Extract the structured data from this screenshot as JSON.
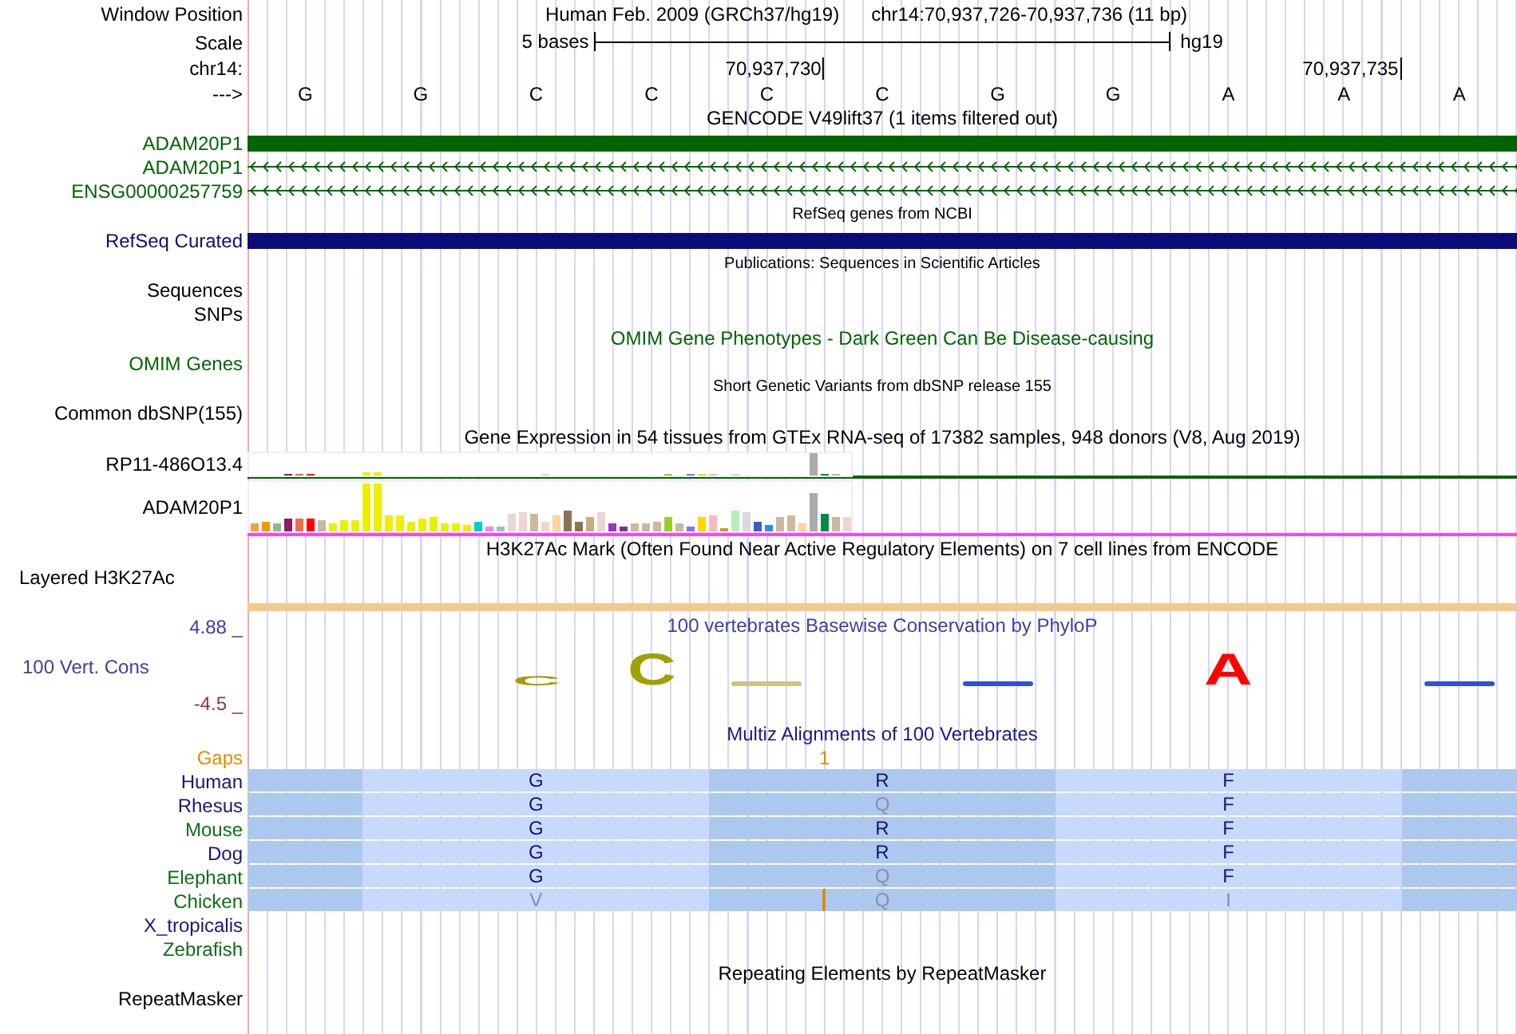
{
  "header": {
    "labels": [
      "Window Position",
      "Scale",
      "chr14:",
      "--->"
    ],
    "assembly": "Human Feb. 2009 (GRCh37/hg19)",
    "region": "chr14:70,937,726-70,937,736 (11 bp)",
    "scale_text": "5 bases",
    "scale_db": "hg19",
    "positions": [
      "70,937,730",
      "70,937,735"
    ],
    "bases": [
      "G",
      "G",
      "C",
      "C",
      "C",
      "C",
      "G",
      "G",
      "A",
      "A",
      "A"
    ]
  },
  "tracks": [
    {
      "kind": "title",
      "text": "GENCODE V49lift37 (1 items filtered out)",
      "color": "#000000"
    },
    {
      "kind": "bar",
      "label": "ADAM20P1",
      "color": "#006400"
    },
    {
      "kind": "arrows",
      "label": "ADAM20P1",
      "color": "#006400"
    },
    {
      "kind": "arrows",
      "label": "ENSG00000257759",
      "color": "#006400"
    },
    {
      "kind": "note",
      "text": "RefSeq genes from NCBI",
      "color": "#000000"
    },
    {
      "kind": "bar",
      "label": "RefSeq Curated",
      "color": "#0c0c78"
    },
    {
      "kind": "note",
      "text": "Publications: Sequences in Scientific Articles",
      "color": "#000000"
    },
    {
      "kind": "empty",
      "label": "Sequences",
      "color": "#000000"
    },
    {
      "kind": "empty",
      "label": "SNPs",
      "color": "#000000"
    },
    {
      "kind": "title",
      "text": "OMIM Gene Phenotypes - Dark Green Can Be Disease-causing",
      "color": "#006400"
    },
    {
      "kind": "empty",
      "label": "OMIM Genes",
      "color": "#006400"
    },
    {
      "kind": "note",
      "text": "Short Genetic Variants from dbSNP release 155",
      "color": "#000000"
    },
    {
      "kind": "empty",
      "label": "Common dbSNP(155)",
      "color": "#000000"
    },
    {
      "kind": "title",
      "text": "Gene Expression in 54 tissues from GTEx RNA-seq of 17382 samples, 948 donors (V8, Aug 2019)",
      "color": "#000000"
    },
    {
      "kind": "gtex",
      "genes": [
        "RP11-486O13.4",
        "ADAM20P1"
      ]
    },
    {
      "kind": "title",
      "text": "H3K27Ac Mark (Often Found Near Active Regulatory Elements) on 7 cell lines from ENCODE",
      "color": "#000000"
    },
    {
      "kind": "layered",
      "label": "Layered H3K27Ac",
      "color": "#000000"
    },
    {
      "kind": "conservation",
      "label": "100 Vert. Cons",
      "title": "100 vertebrates Basewise Conservation by PhyloP",
      "ymax": "4.88 _",
      "ymin": "-4.5 _",
      "logo": [
        {
          "kind": "blank"
        },
        {
          "kind": "blank"
        },
        {
          "kind": "flat",
          "letter": "C",
          "color": "#a0a000"
        },
        {
          "kind": "letter",
          "letter": "C",
          "color": "#a0a000"
        },
        {
          "kind": "line",
          "color": "#c8c880"
        },
        {
          "kind": "blank"
        },
        {
          "kind": "line",
          "color": "#3050e0"
        },
        {
          "kind": "blank"
        },
        {
          "kind": "letter",
          "letter": "A",
          "color": "#ff0000"
        },
        {
          "kind": "blank"
        },
        {
          "kind": "line",
          "color": "#3050e0"
        }
      ]
    },
    {
      "kind": "multiz",
      "title": "Multiz Alignments of 100 Vertebrates",
      "gaps_label": "Gaps",
      "gaps_count": "1",
      "species": [
        {
          "name": "Human",
          "color": "#181878",
          "insertion": false,
          "codons": [
            {
              "letter": "G",
              "match": true
            },
            {
              "letter": "R",
              "match": true
            },
            {
              "letter": "F",
              "match": true
            }
          ]
        },
        {
          "name": "Rhesus",
          "color": "#181878",
          "insertion": false,
          "codons": [
            {
              "letter": "G",
              "match": true
            },
            {
              "letter": "Q",
              "match": false
            },
            {
              "letter": "F",
              "match": true
            }
          ]
        },
        {
          "name": "Mouse",
          "color": "#0e6e14",
          "insertion": false,
          "codons": [
            {
              "letter": "G",
              "match": true
            },
            {
              "letter": "R",
              "match": true
            },
            {
              "letter": "F",
              "match": true
            }
          ]
        },
        {
          "name": "Dog",
          "color": "#181878",
          "insertion": false,
          "codons": [
            {
              "letter": "G",
              "match": true
            },
            {
              "letter": "R",
              "match": true
            },
            {
              "letter": "F",
              "match": true
            }
          ]
        },
        {
          "name": "Elephant",
          "color": "#0e6e14",
          "insertion": false,
          "codons": [
            {
              "letter": "G",
              "match": true
            },
            {
              "letter": "Q",
              "match": false
            },
            {
              "letter": "F",
              "match": true
            }
          ]
        },
        {
          "name": "Chicken",
          "color": "#0e6e14",
          "insertion": true,
          "codons": [
            {
              "letter": "V",
              "match": false
            },
            {
              "letter": "Q",
              "match": false
            },
            {
              "letter": "I",
              "match": false
            }
          ]
        },
        {
          "name": "X_tropicalis",
          "color": "#181878",
          "insertion": false
        },
        {
          "name": "Zebrafish",
          "color": "#0e6e14",
          "insertion": false
        }
      ]
    },
    {
      "kind": "title",
      "text": "Repeating Elements by RepeatMasker",
      "color": "#000000"
    },
    {
      "kind": "empty",
      "label": "RepeatMasker",
      "color": "#000000"
    }
  ]
}
